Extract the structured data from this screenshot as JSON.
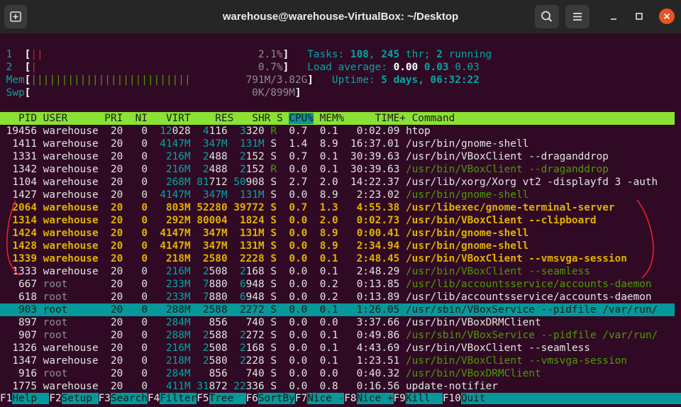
{
  "window": {
    "title": "warehouse@warehouse-VirtualBox: ~/Desktop",
    "new_tab_icon": "new-tab-icon",
    "search_icon": "search-icon",
    "menu_icon": "hamburger-menu-icon",
    "minimize_icon": "minimize-icon",
    "maximize_icon": "maximize-icon",
    "close_icon": "close-icon",
    "close_color": "#e95420"
  },
  "meters": {
    "cpu1": {
      "label": "1",
      "bar": "||",
      "value": "2.1%"
    },
    "cpu2": {
      "label": "2",
      "bar": "|",
      "value": "0.7%"
    },
    "mem": {
      "label": "Mem",
      "bar": "||||||||||||||||||||||||||",
      "value": "791M/3.82G"
    },
    "swp": {
      "label": "Swp",
      "bar": "",
      "value": "0K/899M"
    },
    "tasks": {
      "label": "Tasks:",
      "tasks": "108",
      "threads": "245",
      "thr_label": "thr;",
      "running": "2",
      "running_label": "running"
    },
    "load": {
      "label": "Load average:",
      "v1": "0.00",
      "v2": "0.03",
      "v3": "0.03"
    },
    "uptime": {
      "label": "Uptime:",
      "value": "5 days, 06:32:22"
    }
  },
  "table": {
    "headers": [
      "PID",
      "USER",
      "PRI",
      "NI",
      "VIRT",
      "RES",
      "SHR",
      "S",
      "CPU%",
      "MEM%",
      "TIME+",
      "Command"
    ],
    "sorted_column": "CPU%",
    "rows": [
      {
        "pid": "19456",
        "user": "warehouse",
        "pri": "20",
        "ni": "0",
        "virt": "12028",
        "res": "4116",
        "shr": "3320",
        "s": "R",
        "cpu": "0.7",
        "mem": "0.1",
        "time": "0:02.09",
        "cmd": "htop",
        "style": "normal"
      },
      {
        "pid": "1411",
        "user": "warehouse",
        "pri": "20",
        "ni": "0",
        "virt": "4147M",
        "res": "347M",
        "shr": "131M",
        "s": "S",
        "cpu": "1.4",
        "mem": "8.9",
        "time": "16:37.01",
        "cmd": "/usr/bin/gnome-shell",
        "style": "normal"
      },
      {
        "pid": "1331",
        "user": "warehouse",
        "pri": "20",
        "ni": "0",
        "virt": "216M",
        "res": "2488",
        "shr": "2152",
        "s": "S",
        "cpu": "0.7",
        "mem": "0.1",
        "time": "30:39.63",
        "cmd": "/usr/bin/VBoxClient --draganddrop",
        "style": "normal"
      },
      {
        "pid": "1342",
        "user": "warehouse",
        "pri": "20",
        "ni": "0",
        "virt": "216M",
        "res": "2488",
        "shr": "2152",
        "s": "R",
        "cpu": "0.0",
        "mem": "0.1",
        "time": "30:39.63",
        "cmd": "/usr/bin/VBoxClient --draganddrop",
        "style": "thread"
      },
      {
        "pid": "1104",
        "user": "warehouse",
        "pri": "20",
        "ni": "0",
        "virt": "268M",
        "res": "81712",
        "shr": "50908",
        "s": "S",
        "cpu": "2.7",
        "mem": "2.0",
        "time": "14:22.37",
        "cmd": "/usr/lib/xorg/Xorg vt2 -displayfd 3 -auth",
        "style": "normal"
      },
      {
        "pid": "1427",
        "user": "warehouse",
        "pri": "20",
        "ni": "0",
        "virt": "4147M",
        "res": "347M",
        "shr": "131M",
        "s": "S",
        "cpu": "0.0",
        "mem": "8.9",
        "time": "2:23.02",
        "cmd": "/usr/bin/gnome-shell",
        "style": "thread"
      },
      {
        "pid": "2064",
        "user": "warehouse",
        "pri": "20",
        "ni": "0",
        "virt": "803M",
        "res": "52280",
        "shr": "39772",
        "s": "S",
        "cpu": "0.7",
        "mem": "1.3",
        "time": "4:55.38",
        "cmd": "/usr/libexec/gnome-terminal-server",
        "style": "tagged"
      },
      {
        "pid": "1314",
        "user": "warehouse",
        "pri": "20",
        "ni": "0",
        "virt": "292M",
        "res": "80004",
        "shr": "1824",
        "s": "S",
        "cpu": "0.0",
        "mem": "2.0",
        "time": "0:02.73",
        "cmd": "/usr/bin/VBoxClient --clipboard",
        "style": "tagged"
      },
      {
        "pid": "1424",
        "user": "warehouse",
        "pri": "20",
        "ni": "0",
        "virt": "4147M",
        "res": "347M",
        "shr": "131M",
        "s": "S",
        "cpu": "0.0",
        "mem": "8.9",
        "time": "0:00.41",
        "cmd": "/usr/bin/gnome-shell",
        "style": "tagged"
      },
      {
        "pid": "1428",
        "user": "warehouse",
        "pri": "20",
        "ni": "0",
        "virt": "4147M",
        "res": "347M",
        "shr": "131M",
        "s": "S",
        "cpu": "0.0",
        "mem": "8.9",
        "time": "2:34.94",
        "cmd": "/usr/bin/gnome-shell",
        "style": "tagged"
      },
      {
        "pid": "1339",
        "user": "warehouse",
        "pri": "20",
        "ni": "0",
        "virt": "218M",
        "res": "2580",
        "shr": "2228",
        "s": "S",
        "cpu": "0.0",
        "mem": "0.1",
        "time": "2:48.45",
        "cmd": "/usr/bin/VBoxClient --vmsvga-session",
        "style": "tagged"
      },
      {
        "pid": "1333",
        "user": "warehouse",
        "pri": "20",
        "ni": "0",
        "virt": "216M",
        "res": "2508",
        "shr": "2168",
        "s": "S",
        "cpu": "0.0",
        "mem": "0.1",
        "time": "2:48.29",
        "cmd": "/usr/bin/VBoxClient --seamless",
        "style": "thread"
      },
      {
        "pid": "667",
        "user": "root",
        "pri": "20",
        "ni": "0",
        "virt": "233M",
        "res": "7880",
        "shr": "6948",
        "s": "S",
        "cpu": "0.0",
        "mem": "0.2",
        "time": "0:13.85",
        "cmd": "/usr/lib/accountsservice/accounts-daemon",
        "style": "thread-root"
      },
      {
        "pid": "618",
        "user": "root",
        "pri": "20",
        "ni": "0",
        "virt": "233M",
        "res": "7880",
        "shr": "6948",
        "s": "S",
        "cpu": "0.0",
        "mem": "0.2",
        "time": "0:13.89",
        "cmd": "/usr/lib/accountsservice/accounts-daemon",
        "style": "root"
      },
      {
        "pid": "903",
        "user": "root",
        "pri": "20",
        "ni": "0",
        "virt": "288M",
        "res": "2588",
        "shr": "2272",
        "s": "S",
        "cpu": "0.0",
        "mem": "0.1",
        "time": "1:26.05",
        "cmd": "/usr/sbin/VBoxService --pidfile /var/run/",
        "style": "selected"
      },
      {
        "pid": "897",
        "user": "root",
        "pri": "20",
        "ni": "0",
        "virt": "284M",
        "res": "856",
        "shr": "740",
        "s": "S",
        "cpu": "0.0",
        "mem": "0.0",
        "time": "3:37.66",
        "cmd": "/usr/bin/VBoxDRMClient",
        "style": "root"
      },
      {
        "pid": "907",
        "user": "root",
        "pri": "20",
        "ni": "0",
        "virt": "288M",
        "res": "2588",
        "shr": "2272",
        "s": "S",
        "cpu": "0.0",
        "mem": "0.1",
        "time": "0:49.86",
        "cmd": "/usr/sbin/VBoxService --pidfile /var/run/",
        "style": "thread-root"
      },
      {
        "pid": "1326",
        "user": "warehouse",
        "pri": "20",
        "ni": "0",
        "virt": "216M",
        "res": "2508",
        "shr": "2168",
        "s": "S",
        "cpu": "0.0",
        "mem": "0.1",
        "time": "4:43.69",
        "cmd": "/usr/bin/VBoxClient --seamless",
        "style": "normal"
      },
      {
        "pid": "1347",
        "user": "warehouse",
        "pri": "20",
        "ni": "0",
        "virt": "218M",
        "res": "2580",
        "shr": "2228",
        "s": "S",
        "cpu": "0.0",
        "mem": "0.1",
        "time": "1:23.51",
        "cmd": "/usr/bin/VBoxClient --vmsvga-session",
        "style": "thread"
      },
      {
        "pid": "916",
        "user": "root",
        "pri": "20",
        "ni": "0",
        "virt": "284M",
        "res": "856",
        "shr": "740",
        "s": "S",
        "cpu": "0.0",
        "mem": "0.0",
        "time": "0:40.32",
        "cmd": "/usr/bin/VBoxDRMClient",
        "style": "thread-root"
      },
      {
        "pid": "1775",
        "user": "warehouse",
        "pri": "20",
        "ni": "0",
        "virt": "411M",
        "res": "31872",
        "shr": "22336",
        "s": "S",
        "cpu": "0.0",
        "mem": "0.8",
        "time": "0:16.56",
        "cmd": "update-notifier",
        "style": "normal"
      }
    ]
  },
  "function_keys": [
    {
      "key": "F1",
      "label": "Help"
    },
    {
      "key": "F2",
      "label": "Setup"
    },
    {
      "key": "F3",
      "label": "Search"
    },
    {
      "key": "F4",
      "label": "Filter"
    },
    {
      "key": "F5",
      "label": "Tree"
    },
    {
      "key": "F6",
      "label": "SortBy"
    },
    {
      "key": "F7",
      "label": "Nice -"
    },
    {
      "key": "F8",
      "label": "Nice +"
    },
    {
      "key": "F9",
      "label": "Kill"
    },
    {
      "key": "F10",
      "label": "Quit"
    }
  ],
  "annotation_color": "#e8202a"
}
